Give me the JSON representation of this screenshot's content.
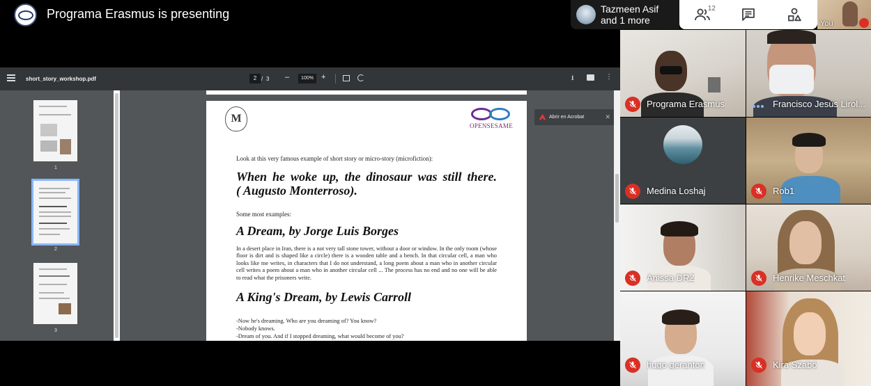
{
  "meeting": {
    "presenting_title": "Programa Erasmus is presenting",
    "active_speaker": {
      "line1": "Tazmeen Asif",
      "line2": "and 1 more"
    },
    "toolbar": {
      "people_icon": "people-icon",
      "people_count": "12",
      "chat_icon": "chat-icon",
      "activities_icon": "activities-icon"
    },
    "self_label": "You"
  },
  "pdf": {
    "filename": "short_story_workshop.pdf",
    "page_current": "2",
    "page_sep": "/",
    "page_total": "3",
    "zoom": "100%",
    "minus": "–",
    "plus": "+",
    "download": "⭳",
    "more": "⋮",
    "acrobat_label": "Abrir en Acrobat",
    "acrobat_close": "✕",
    "thumbnails": [
      {
        "label": "1"
      },
      {
        "label": "2"
      },
      {
        "label": "3"
      }
    ],
    "page": {
      "seal_letter": "M",
      "logo_word": "OPENSESAME",
      "intro": "Look at this very famous example of short story or micro-story (microfiction):",
      "quote_line1": "When he woke up, the dinosaur was still there.",
      "quote_line2": "( Augusto Monterroso).",
      "examples": "Some most examples:",
      "heading1": "A Dream, by Jorge Luis Borges",
      "body1": "In a desert place in Iran, there is a not very tall stone tower, without a door or window. In the only room (whose floor is dirt and is shaped like a circle) there is a wooden table and a bench. In that circular cell, a man who looks like me writes, in characters that I do not understand, a long poem about a man who in another circular cell writes a poem about a man who in another circular cell ... The process has no end and no one will be able to read what the prisoners write.",
      "heading2": "A King's Dream, by Lewis Carroll",
      "dialog1": "-Now he's dreaming. Who are you dreaming of? You know?",
      "dialog2": "-Nobody knows.",
      "dialog3": "-Dream of you. And if I stopped dreaming, what would become of you?"
    }
  },
  "participants": [
    {
      "name": "Programa Erasmus",
      "status": "muted"
    },
    {
      "name": "Francisco Jesús Lirol...",
      "status": "speaking"
    },
    {
      "name": "Medina Loshaj",
      "status": "muted"
    },
    {
      "name": "Rob1",
      "status": "muted"
    },
    {
      "name": "Anissa DRZ",
      "status": "muted"
    },
    {
      "name": "Henrike Meschkat",
      "status": "muted"
    },
    {
      "name": "hugo geranton",
      "status": "muted"
    },
    {
      "name": "Kira Szabó",
      "status": "muted"
    }
  ],
  "colors": {
    "mute_red": "#d93025",
    "pdf_toolbar": "#323639",
    "pdf_canvas": "#525659",
    "selection_blue": "#8ab4f8"
  }
}
